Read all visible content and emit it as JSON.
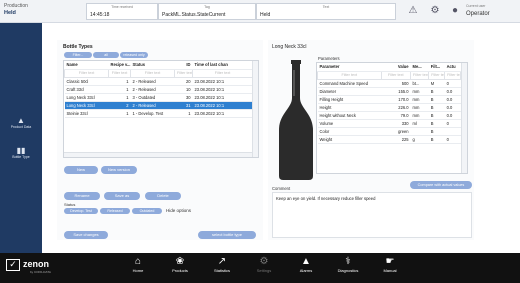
{
  "header": {
    "production_label": "Production",
    "production_state": "Held",
    "time_received_caption": "Time received",
    "time_received_value": "14:45:18",
    "tag_caption": "Tag",
    "tag_value": "PackML.Status.StateCurrent",
    "text_caption": "Text",
    "text_value": "Held",
    "current_user_caption": "Current user",
    "current_user_value": "Operator"
  },
  "left_nav": [
    {
      "label": "Product Data",
      "icon": "product-data-icon"
    },
    {
      "label": "Bottle Type",
      "icon": "bottle-type-icon"
    }
  ],
  "bottle_types": {
    "title": "Bottle Types",
    "filters": [
      "Filter...",
      "all",
      "released only"
    ],
    "columns": [
      "Name",
      "Recipe v...",
      "Status",
      "ID",
      "Time of last chan"
    ],
    "filter_placeholder": "Filter text",
    "rows": [
      {
        "name": "Classic 50cl",
        "version": "1",
        "status": "2 - Released",
        "id": "20",
        "time": "23.08.2022 10:1"
      },
      {
        "name": "Craft 33cl",
        "version": "1",
        "status": "2 - Released",
        "id": "10",
        "time": "23.08.2022 10:1"
      },
      {
        "name": "Long Neck 33cl",
        "version": "1",
        "status": "3 - Outdated",
        "id": "30",
        "time": "23.08.2022 10:1"
      },
      {
        "name": "Long Neck 33cl",
        "version": "2",
        "status": "2 - Released",
        "id": "31",
        "time": "23.08.2022 10:1"
      },
      {
        "name": "Steinie 33cl",
        "version": "1",
        "status": "1 - Develop. Test",
        "id": "1",
        "time": "23.08.2022 10:1"
      }
    ],
    "selected_row": 3,
    "new_label": "New",
    "new_version_label": "New version",
    "rename_label": "Rename",
    "save_as_label": "Save as",
    "delete_label": "Delete",
    "status_label": "Status",
    "status_buttons": [
      "Develop. Test",
      "Released",
      "Outdated"
    ],
    "hide_options_label": "Hide options",
    "save_changes_label": "Save changes",
    "select_bottle_type_label": "select bottle type"
  },
  "detail": {
    "title": "Long Neck 33cl",
    "parameters_title": "Parameters",
    "columns": [
      "Parameter",
      "Value",
      "Me...",
      "Filt...",
      "Actu"
    ],
    "filter_placeholder": "Filter text",
    "params": [
      {
        "name": "Command Machine Speed",
        "value": "500",
        "unit": "bt...",
        "filt": "M",
        "act": "0"
      },
      {
        "name": "Diameter",
        "value": "155.0",
        "unit": "mm",
        "filt": "B",
        "act": "0.0"
      },
      {
        "name": "Filling Height",
        "value": "170.0",
        "unit": "mm",
        "filt": "B",
        "act": "0.0"
      },
      {
        "name": "Height",
        "value": "226.0",
        "unit": "mm",
        "filt": "B",
        "act": "0.0"
      },
      {
        "name": "Height without Neck",
        "value": "79.0",
        "unit": "mm",
        "filt": "B",
        "act": "0.0"
      },
      {
        "name": "Volume",
        "value": "330",
        "unit": "ml",
        "filt": "B",
        "act": "0"
      },
      {
        "name": "Color",
        "value": "green",
        "unit": "",
        "filt": "B",
        "act": ""
      },
      {
        "name": "Weight",
        "value": "225",
        "unit": "g",
        "filt": "B",
        "act": "0"
      }
    ],
    "compare_label": "Compare with actual values",
    "comment_label": "Comment",
    "comment_text": "Keep an eye on yield. If necessary reduce filler speed"
  },
  "bottom_nav": [
    {
      "label": "Home",
      "icon": "home-icon"
    },
    {
      "label": "Products",
      "icon": "products-icon"
    },
    {
      "label": "Statistics",
      "icon": "statistics-icon"
    },
    {
      "label": "Settings",
      "icon": "settings-icon"
    },
    {
      "label": "Alarms",
      "icon": "alarm-icon"
    },
    {
      "label": "Diagnostics",
      "icon": "diagnostics-icon"
    },
    {
      "label": "Manual",
      "icon": "manual-icon"
    }
  ],
  "brand": {
    "name": "zenon",
    "tagline": "by COPA-DATA"
  },
  "colors": {
    "accent": "#8eaadb",
    "selected": "#2f80d0",
    "nav": "#1f3a63",
    "bottom_bar": "#111111"
  }
}
